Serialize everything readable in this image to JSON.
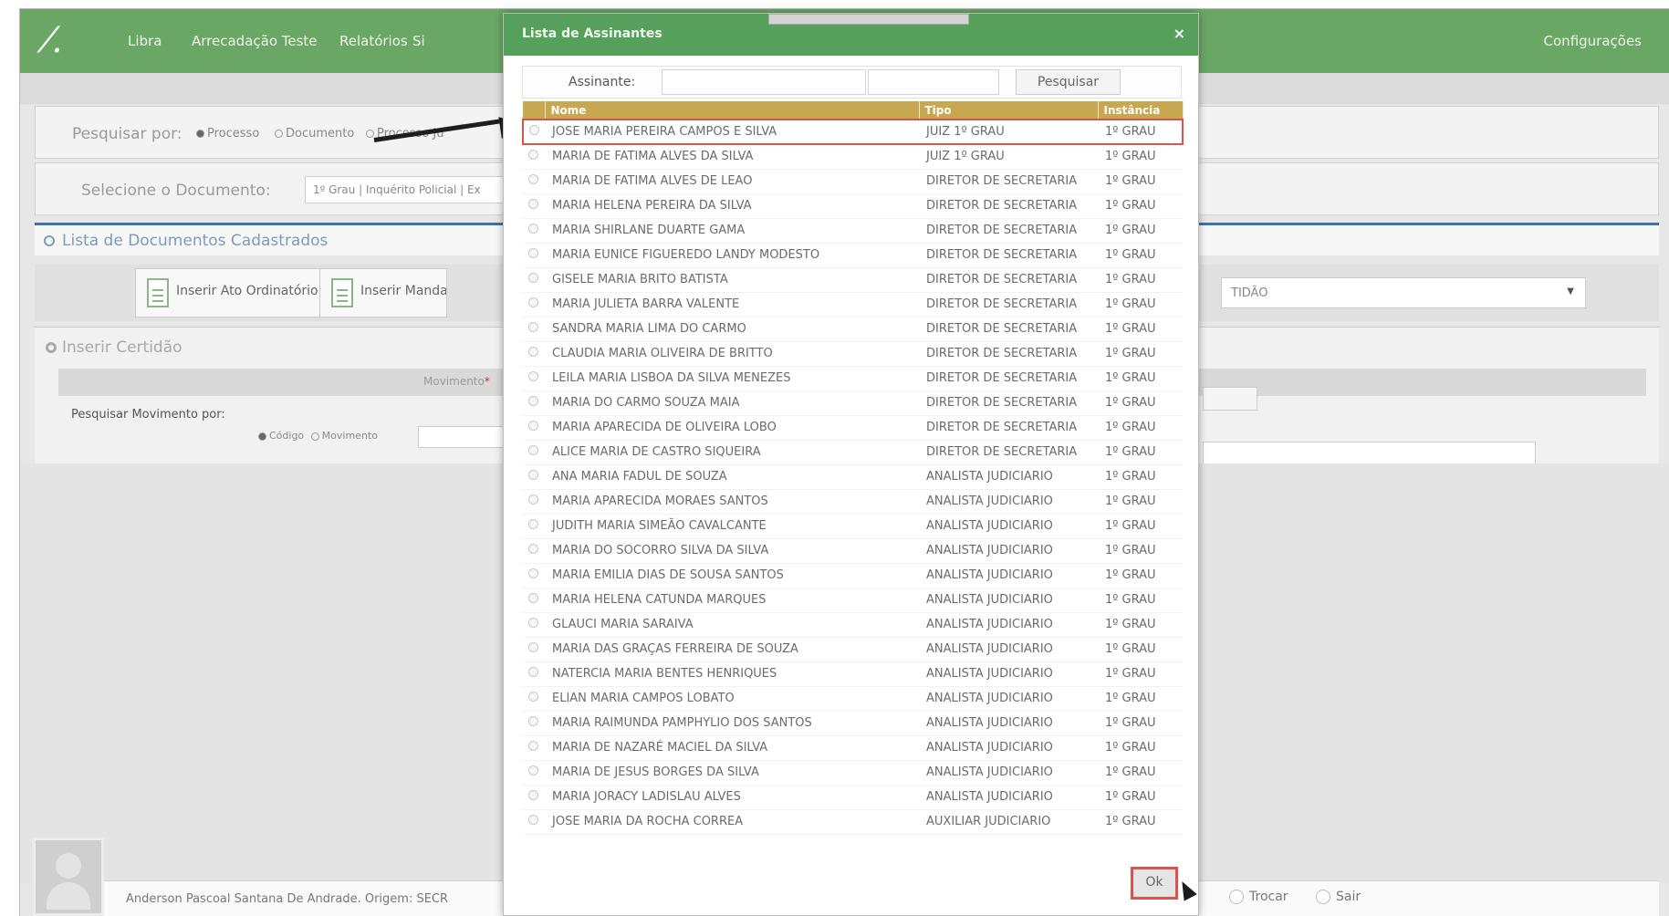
{
  "nav": {
    "items": [
      "Libra",
      "Arrecadação Teste",
      "Relatórios",
      "Si"
    ],
    "config": "Configurações"
  },
  "search": {
    "label": "Pesquisar por:",
    "options": [
      "Processo",
      "Documento",
      "Processo Ju"
    ]
  },
  "select_doc": {
    "label": "Selecione o Documento:",
    "value": "1º Grau | Inquérito Policial | Ex"
  },
  "list": {
    "title": "Lista de Documentos Cadastrados",
    "buttons": [
      "Inserir Ato Ordinatório",
      "Inserir Mandado"
    ],
    "type_value": "TIDÃO"
  },
  "cert": {
    "title": "Inserir Certidão",
    "mov_label": "Movimento",
    "required_mark": "*",
    "search_label": "Pesquisar Movimento por:",
    "options": [
      "Código",
      "Movimento"
    ]
  },
  "footer": {
    "user": "Anderson Pascoal Santana De Andrade. Origem: SECR",
    "trocar": "Trocar",
    "sair": "Sair"
  },
  "modal": {
    "title": "Lista de Assinantes",
    "close": "×",
    "assinante_label": "Assinante:",
    "search_button": "Pesquisar",
    "columns": [
      "Nome",
      "Tipo",
      "Instância"
    ],
    "rows": [
      {
        "nome": "JOSE MARIA PEREIRA CAMPOS E SILVA",
        "tipo": "JUIZ 1º GRAU",
        "inst": "1º GRAU"
      },
      {
        "nome": "MARIA DE FATIMA ALVES DA SILVA",
        "tipo": "JUIZ 1º GRAU",
        "inst": "1º GRAU"
      },
      {
        "nome": "MARIA DE FATIMA ALVES DE LEAO",
        "tipo": "DIRETOR DE SECRETARIA",
        "inst": "1º GRAU"
      },
      {
        "nome": "MARIA HELENA PEREIRA DA SILVA",
        "tipo": "DIRETOR DE SECRETARIA",
        "inst": "1º GRAU"
      },
      {
        "nome": "MARIA SHIRLANE DUARTE GAMA",
        "tipo": "DIRETOR DE SECRETARIA",
        "inst": "1º GRAU"
      },
      {
        "nome": "MARIA EUNICE FIGUEREDO LANDY MODESTO",
        "tipo": "DIRETOR DE SECRETARIA",
        "inst": "1º GRAU"
      },
      {
        "nome": "GISELE MARIA BRITO BATISTA",
        "tipo": "DIRETOR DE SECRETARIA",
        "inst": "1º GRAU"
      },
      {
        "nome": "MARIA JULIETA BARRA VALENTE",
        "tipo": "DIRETOR DE SECRETARIA",
        "inst": "1º GRAU"
      },
      {
        "nome": "SANDRA MARIA LIMA DO CARMO",
        "tipo": "DIRETOR DE SECRETARIA",
        "inst": "1º GRAU"
      },
      {
        "nome": "CLAUDIA MARIA OLIVEIRA DE BRITTO",
        "tipo": "DIRETOR DE SECRETARIA",
        "inst": "1º GRAU"
      },
      {
        "nome": "LEILA MARIA LISBOA DA SILVA MENEZES",
        "tipo": "DIRETOR DE SECRETARIA",
        "inst": "1º GRAU"
      },
      {
        "nome": "MARIA DO CARMO SOUZA MAIA",
        "tipo": "DIRETOR DE SECRETARIA",
        "inst": "1º GRAU"
      },
      {
        "nome": "MARIA APARECIDA DE OLIVEIRA LOBO",
        "tipo": "DIRETOR DE SECRETARIA",
        "inst": "1º GRAU"
      },
      {
        "nome": "ALICE MARIA DE CASTRO SIQUEIRA",
        "tipo": "DIRETOR DE SECRETARIA",
        "inst": "1º GRAU"
      },
      {
        "nome": "ANA MARIA FADUL DE SOUZA",
        "tipo": "ANALISTA JUDICIARIO",
        "inst": "1º GRAU"
      },
      {
        "nome": "MARIA APARECIDA MORAES SANTOS",
        "tipo": "ANALISTA JUDICIARIO",
        "inst": "1º GRAU"
      },
      {
        "nome": "JUDITH MARIA SIMEÃO CAVALCANTE",
        "tipo": "ANALISTA JUDICIARIO",
        "inst": "1º GRAU"
      },
      {
        "nome": "MARIA DO SOCORRO SILVA DA SILVA",
        "tipo": "ANALISTA JUDICIARIO",
        "inst": "1º GRAU"
      },
      {
        "nome": "MARIA EMILIA DIAS DE SOUSA SANTOS",
        "tipo": "ANALISTA JUDICIARIO",
        "inst": "1º GRAU"
      },
      {
        "nome": "MARIA HELENA CATUNDA MARQUES",
        "tipo": "ANALISTA JUDICIARIO",
        "inst": "1º GRAU"
      },
      {
        "nome": "GLAUCI MARIA SARAIVA",
        "tipo": "ANALISTA JUDICIARIO",
        "inst": "1º GRAU"
      },
      {
        "nome": "MARIA DAS GRAÇAS FERREIRA DE SOUZA",
        "tipo": "ANALISTA JUDICIARIO",
        "inst": "1º GRAU"
      },
      {
        "nome": "NATERCIA MARIA BENTES HENRIQUES",
        "tipo": "ANALISTA JUDICIARIO",
        "inst": "1º GRAU"
      },
      {
        "nome": "ELIAN MARIA CAMPOS LOBATO",
        "tipo": "ANALISTA JUDICIARIO",
        "inst": "1º GRAU"
      },
      {
        "nome": "MARIA RAIMUNDA PAMPHYLIO DOS SANTOS",
        "tipo": "ANALISTA JUDICIARIO",
        "inst": "1º GRAU"
      },
      {
        "nome": "MARIA DE NAZARÉ MACIEL DA SILVA",
        "tipo": "ANALISTA JUDICIARIO",
        "inst": "1º GRAU"
      },
      {
        "nome": "MARIA DE JESUS BORGES DA SILVA",
        "tipo": "ANALISTA JUDICIARIO",
        "inst": "1º GRAU"
      },
      {
        "nome": "MARIA JORACY LADISLAU ALVES",
        "tipo": "ANALISTA JUDICIARIO",
        "inst": "1º GRAU"
      },
      {
        "nome": "JOSE MARIA DA ROCHA CORREA",
        "tipo": "AUXILIAR JUDICIARIO",
        "inst": "1º GRAU"
      }
    ],
    "highlighted_row": 0,
    "ok_button": "Ok"
  },
  "colors": {
    "nav_green": "#6aa765",
    "modal_title_green": "#55a05a",
    "table_header_gold": "#c7a750",
    "highlight_red": "#d9534f",
    "section_blue": "#3c73a8"
  }
}
